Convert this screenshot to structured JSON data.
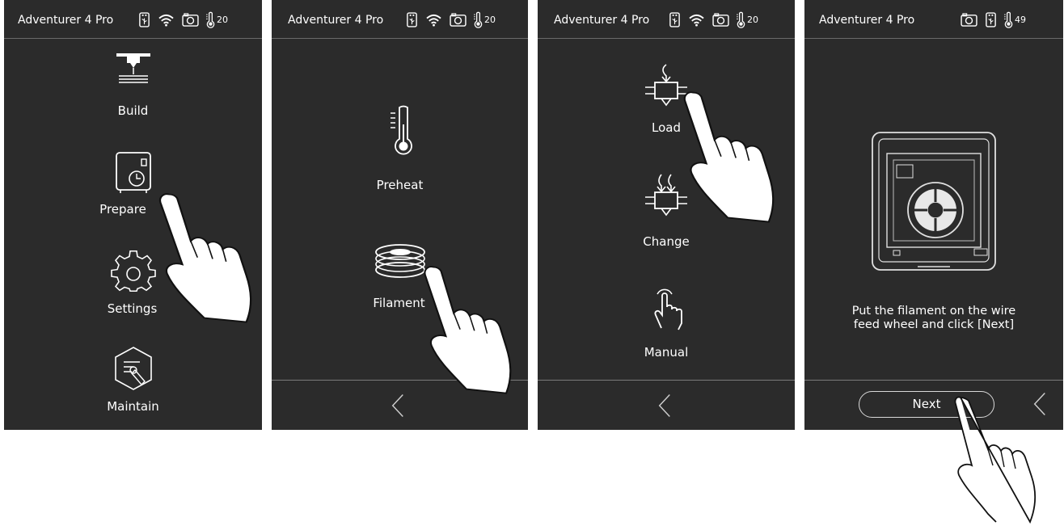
{
  "screens": [
    {
      "title": "Adventurer 4 Pro",
      "temperature": "20",
      "menu": [
        {
          "label": "Build",
          "icon": "build-icon"
        },
        {
          "label": "Prepare",
          "icon": "prepare-icon"
        },
        {
          "label": "Settings",
          "icon": "gear-icon"
        },
        {
          "label": "Maintain",
          "icon": "maintain-icon"
        }
      ]
    },
    {
      "title": "Adventurer 4 Pro",
      "temperature": "20",
      "menu": [
        {
          "label": "Preheat",
          "icon": "thermometer-icon"
        },
        {
          "label": "Filament",
          "icon": "filament-spool-icon"
        }
      ],
      "back_icon": "chevron-left-icon"
    },
    {
      "title": "Adventurer 4 Pro",
      "temperature": "20",
      "menu": [
        {
          "label": "Load",
          "icon": "load-filament-icon"
        },
        {
          "label": "Change",
          "icon": "change-filament-icon"
        },
        {
          "label": "Manual",
          "icon": "hand-tap-icon"
        }
      ],
      "back_icon": "chevron-left-icon"
    },
    {
      "title": "Adventurer 4 Pro",
      "temperature": "49",
      "message_line1": "Put the filament on the wire",
      "message_line2": "feed wheel and click [Next]",
      "next_label": "Next",
      "back_icon": "chevron-left-icon"
    }
  ],
  "colors": {
    "screen_bg": "#2b2b2b",
    "text": "#ffffff",
    "divider": "#7a7a7a"
  }
}
